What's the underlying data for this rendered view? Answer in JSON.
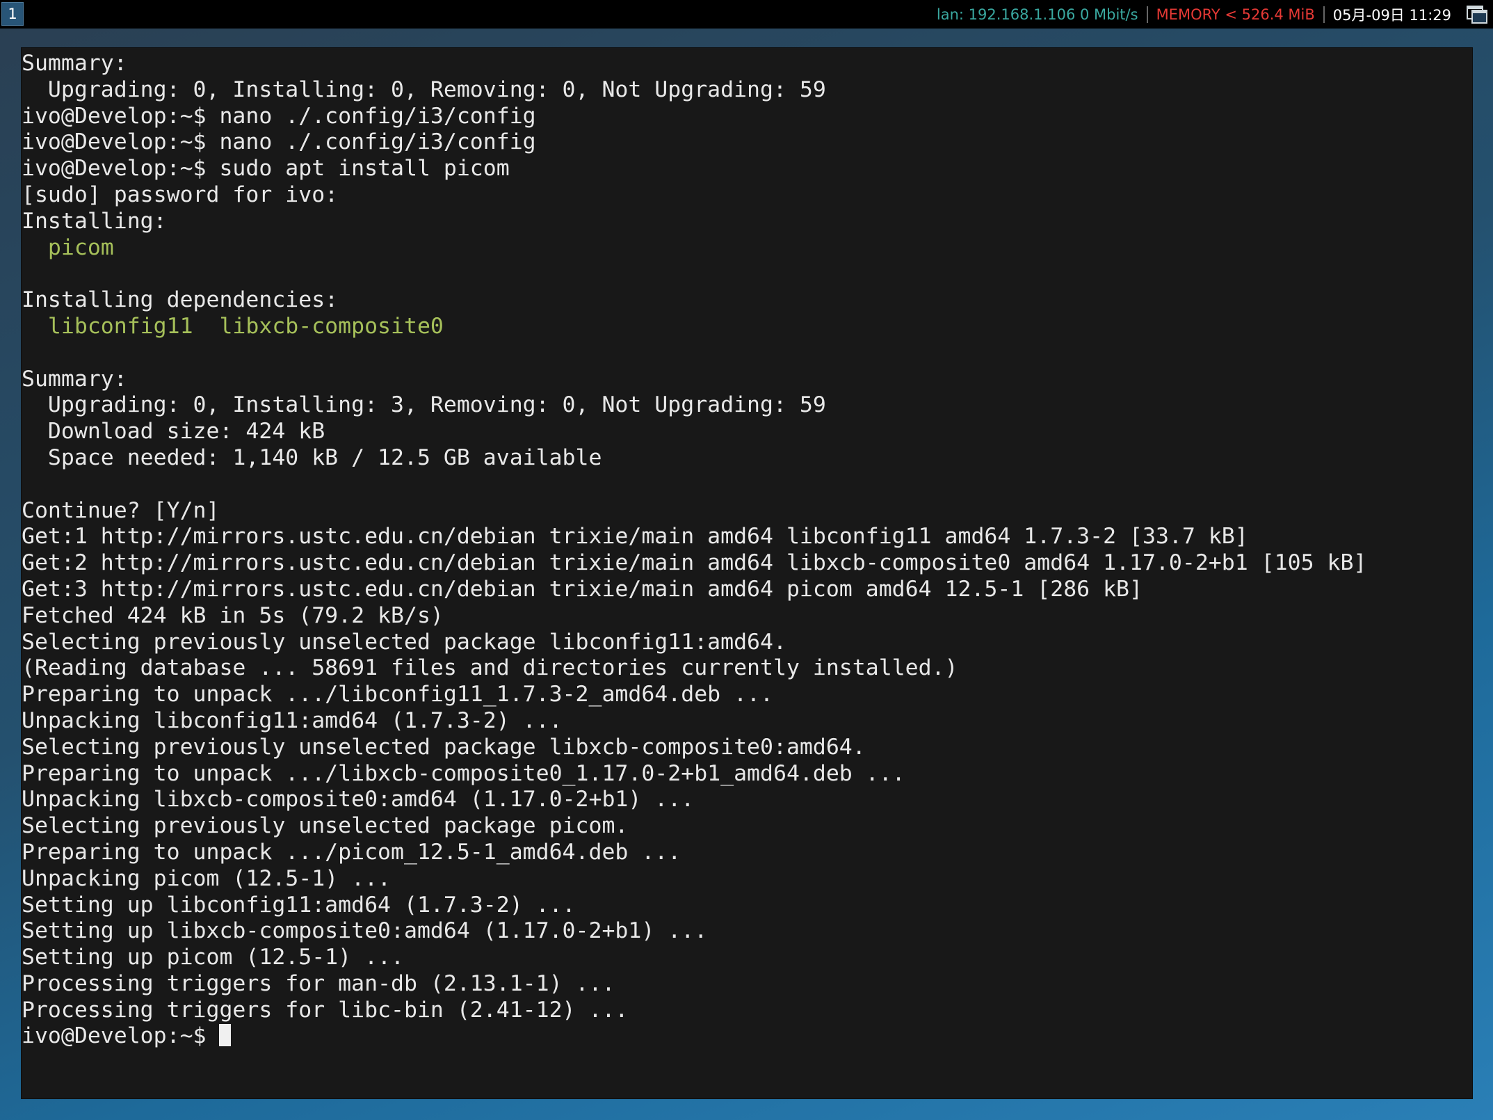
{
  "bar": {
    "workspace": "1",
    "lan": "lan: 192.168.1.106 0 Mbit/s",
    "memory": "MEMORY < 526.4 MiB",
    "datetime": "05月-09日 11:29",
    "tray_icon": "window-icon"
  },
  "terminal": {
    "lines": [
      "Summary:",
      "  Upgrading: 0, Installing: 0, Removing: 0, Not Upgrading: 59",
      "ivo@Develop:~$ nano ./.config/i3/config",
      "ivo@Develop:~$ nano ./.config/i3/config",
      "ivo@Develop:~$ sudo apt install picom",
      "[sudo] password for ivo:",
      "Installing:",
      "  picom",
      "",
      "Installing dependencies:",
      "  libconfig11  libxcb-composite0",
      "",
      "Summary:",
      "  Upgrading: 0, Installing: 3, Removing: 0, Not Upgrading: 59",
      "  Download size: 424 kB",
      "  Space needed: 1,140 kB / 12.5 GB available",
      "",
      "Continue? [Y/n]",
      "Get:1 http://mirrors.ustc.edu.cn/debian trixie/main amd64 libconfig11 amd64 1.7.3-2 [33.7 kB]",
      "Get:2 http://mirrors.ustc.edu.cn/debian trixie/main amd64 libxcb-composite0 amd64 1.17.0-2+b1 [105 kB]",
      "Get:3 http://mirrors.ustc.edu.cn/debian trixie/main amd64 picom amd64 12.5-1 [286 kB]",
      "Fetched 424 kB in 5s (79.2 kB/s)",
      "Selecting previously unselected package libconfig11:amd64.",
      "(Reading database ... 58691 files and directories currently installed.)",
      "Preparing to unpack .../libconfig11_1.7.3-2_amd64.deb ...",
      "Unpacking libconfig11:amd64 (1.7.3-2) ...",
      "Selecting previously unselected package libxcb-composite0:amd64.",
      "Preparing to unpack .../libxcb-composite0_1.17.0-2+b1_amd64.deb ...",
      "Unpacking libxcb-composite0:amd64 (1.17.0-2+b1) ...",
      "Selecting previously unselected package picom.",
      "Preparing to unpack .../picom_12.5-1_amd64.deb ...",
      "Unpacking picom (12.5-1) ...",
      "Setting up libconfig11:amd64 (1.7.3-2) ...",
      "Setting up libxcb-composite0:amd64 (1.17.0-2+b1) ...",
      "Setting up picom (12.5-1) ...",
      "Processing triggers for man-db (2.13.1-1) ...",
      "Processing triggers for libc-bin (2.41-12) ...",
      "ivo@Develop:~$ "
    ],
    "colors": {
      "text": "#e8e8e8",
      "package": "#a6c05a",
      "background": "#181818"
    }
  }
}
